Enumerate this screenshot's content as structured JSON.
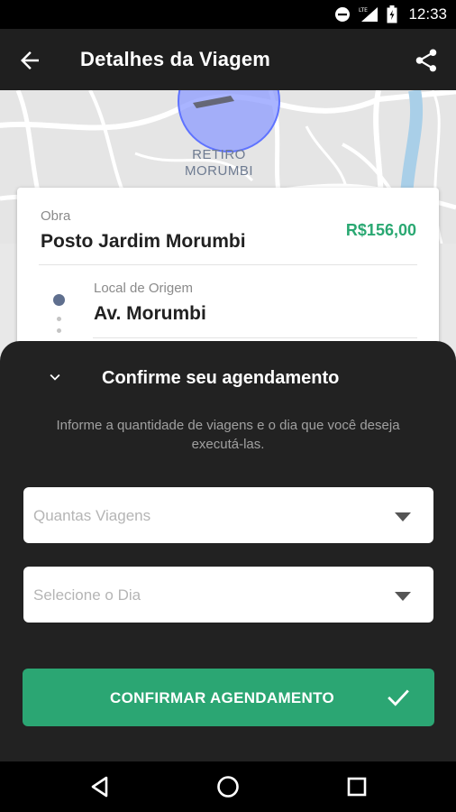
{
  "status_bar": {
    "time": "12:33",
    "network_label": "LTE"
  },
  "app_bar": {
    "title": "Detalhes da Viagem"
  },
  "map": {
    "area_label_line1": "RETIRO",
    "area_label_line2": "MORUMBI",
    "circle_color": "#8c9bff"
  },
  "trip_card": {
    "obra_label": "Obra",
    "obra_value": "Posto Jardim Morumbi",
    "price": "R$156,00",
    "origin_label": "Local de Origem",
    "origin_value": "Av. Morumbi"
  },
  "sheet": {
    "title": "Confirme seu agendamento",
    "description": "Informe a quantidade de viagens e o dia que você deseja executá-las.",
    "trips_placeholder": "Quantas Viagens",
    "day_placeholder": "Selecione o Dia",
    "confirm_label": "CONFIRMAR AGENDAMENTO"
  },
  "colors": {
    "accent_green": "#2ba673",
    "price_green": "#2aa872",
    "sheet_bg": "#222222"
  }
}
